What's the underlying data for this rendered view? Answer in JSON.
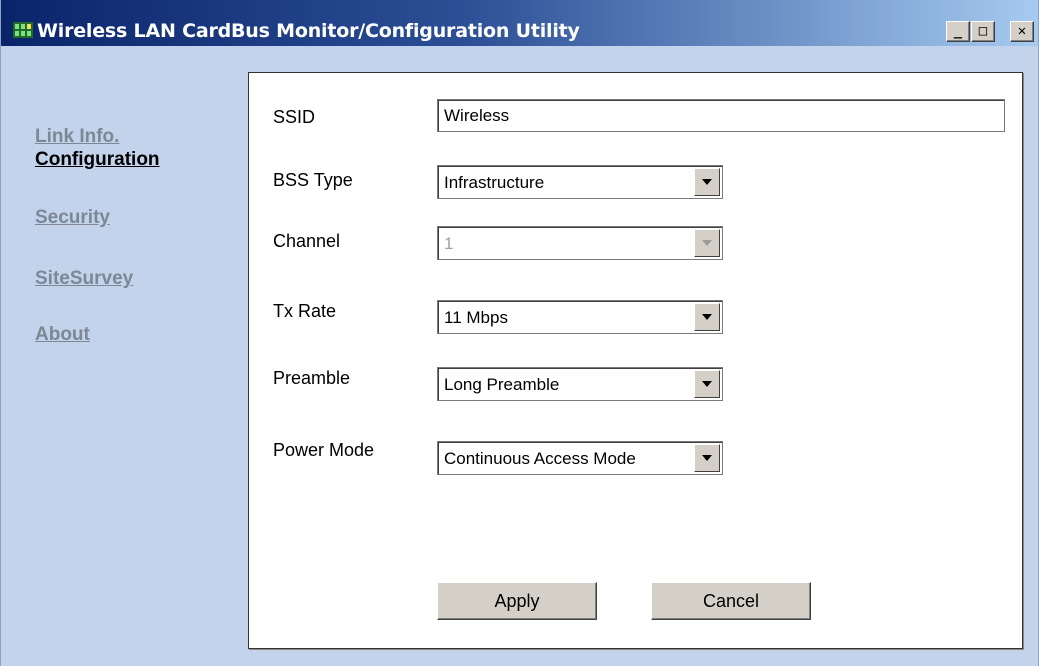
{
  "window": {
    "title": "Wireless LAN CardBus Monitor/Configuration Utility",
    "controls": {
      "minimize": "_",
      "maximize": "□",
      "close": "✕"
    }
  },
  "sidebar": {
    "items": [
      {
        "label": "Link Info.",
        "active": false
      },
      {
        "label": "Configuration",
        "active": true
      },
      {
        "label": "Security",
        "active": false
      },
      {
        "label": "SiteSurvey",
        "active": false
      },
      {
        "label": "About",
        "active": false
      }
    ]
  },
  "form": {
    "ssid": {
      "label": "SSID",
      "value": "Wireless"
    },
    "bss_type": {
      "label": "BSS Type",
      "value": "Infrastructure"
    },
    "channel": {
      "label": "Channel",
      "value": "1",
      "disabled": true
    },
    "tx_rate": {
      "label": "Tx Rate",
      "value": "11 Mbps"
    },
    "preamble": {
      "label": "Preamble",
      "value": "Long Preamble"
    },
    "power_mode": {
      "label": "Power Mode",
      "value": "Continuous Access Mode"
    }
  },
  "buttons": {
    "apply": "Apply",
    "cancel": "Cancel"
  },
  "colors": {
    "background": "#c4d3ec",
    "titlebar_start": "#0a246a",
    "titlebar_end": "#a6caf0",
    "sidebar_inactive": "#7d8795",
    "sidebar_active": "#000000"
  }
}
